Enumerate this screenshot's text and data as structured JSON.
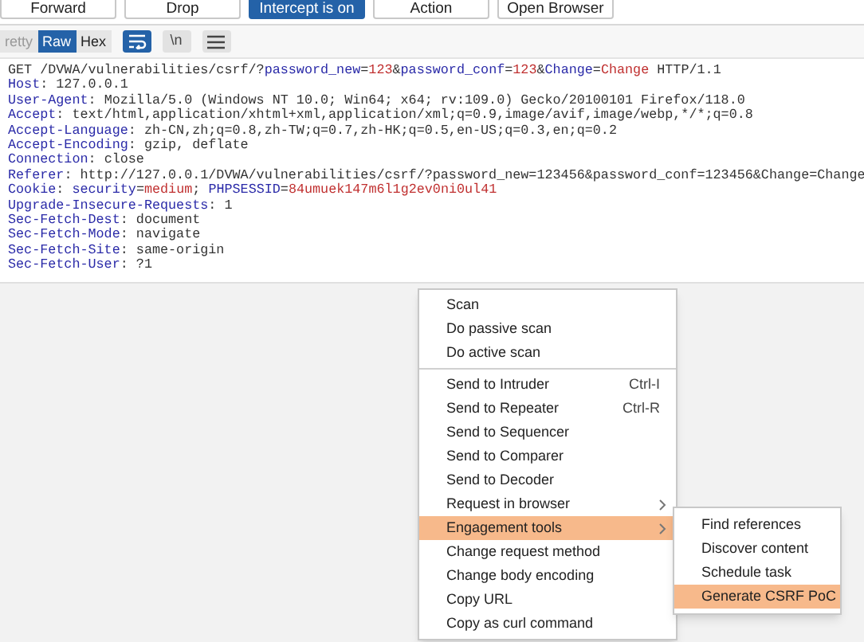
{
  "toolbar": {
    "buttons": [
      {
        "label": "Forward",
        "selected": false
      },
      {
        "label": "Drop",
        "selected": false
      },
      {
        "label": "Intercept is on",
        "selected": true
      },
      {
        "label": "Action",
        "selected": false
      },
      {
        "label": "Open Browser",
        "selected": false
      }
    ]
  },
  "view_tabs": [
    {
      "label": "retty",
      "selected": false,
      "disabled": true
    },
    {
      "label": "Raw",
      "selected": true,
      "disabled": false
    },
    {
      "label": "Hex",
      "selected": false,
      "disabled": false
    }
  ],
  "view_toggles": [
    {
      "kind": "wrap",
      "selected": true
    },
    {
      "kind": "text",
      "label": "\\n",
      "selected": false
    },
    {
      "kind": "menu",
      "selected": false
    }
  ],
  "request_lines": [
    [
      {
        "kind": "plain",
        "text": "GET /DVWA/vulnerabilities/csrf/?"
      },
      {
        "kind": "key",
        "text": "password_new"
      },
      {
        "kind": "plain",
        "text": "="
      },
      {
        "kind": "val",
        "text": "123"
      },
      {
        "kind": "plain",
        "text": "&"
      },
      {
        "kind": "key",
        "text": "password_conf"
      },
      {
        "kind": "plain",
        "text": "="
      },
      {
        "kind": "val",
        "text": "123"
      },
      {
        "kind": "plain",
        "text": "&"
      },
      {
        "kind": "key",
        "text": "Change"
      },
      {
        "kind": "plain",
        "text": "="
      },
      {
        "kind": "val",
        "text": "Change"
      },
      {
        "kind": "plain",
        "text": " HTTP/1.1"
      }
    ],
    [
      {
        "kind": "key",
        "text": "Host"
      },
      {
        "kind": "plain",
        "text": ": 127.0.0.1"
      }
    ],
    [
      {
        "kind": "key",
        "text": "User-Agent"
      },
      {
        "kind": "plain",
        "text": ": Mozilla/5.0 (Windows NT 10.0; Win64; x64; rv:109.0) Gecko/20100101 Firefox/118.0"
      }
    ],
    [
      {
        "kind": "key",
        "text": "Accept"
      },
      {
        "kind": "plain",
        "text": ": text/html,application/xhtml+xml,application/xml;q=0.9,image/avif,image/webp,*/*;q=0.8"
      }
    ],
    [
      {
        "kind": "key",
        "text": "Accept-Language"
      },
      {
        "kind": "plain",
        "text": ": zh-CN,zh;q=0.8,zh-TW;q=0.7,zh-HK;q=0.5,en-US;q=0.3,en;q=0.2"
      }
    ],
    [
      {
        "kind": "key",
        "text": "Accept-Encoding"
      },
      {
        "kind": "plain",
        "text": ": gzip, deflate"
      }
    ],
    [
      {
        "kind": "key",
        "text": "Connection"
      },
      {
        "kind": "plain",
        "text": ": close"
      }
    ],
    [
      {
        "kind": "key",
        "text": "Referer"
      },
      {
        "kind": "plain",
        "text": ": http://127.0.0.1/DVWA/vulnerabilities/csrf/?password_new=123456&password_conf=123456&Change=Change"
      }
    ],
    [
      {
        "kind": "key",
        "text": "Cookie"
      },
      {
        "kind": "plain",
        "text": ": "
      },
      {
        "kind": "key",
        "text": "security"
      },
      {
        "kind": "plain",
        "text": "="
      },
      {
        "kind": "val",
        "text": "medium"
      },
      {
        "kind": "plain",
        "text": "; "
      },
      {
        "kind": "key",
        "text": "PHPSESSID"
      },
      {
        "kind": "plain",
        "text": "="
      },
      {
        "kind": "val",
        "text": "84umuek147m6l1g2ev0ni0ul41"
      }
    ],
    [
      {
        "kind": "key",
        "text": "Upgrade-Insecure-Requests"
      },
      {
        "kind": "plain",
        "text": ": 1"
      }
    ],
    [
      {
        "kind": "key",
        "text": "Sec-Fetch-Dest"
      },
      {
        "kind": "plain",
        "text": ": document"
      }
    ],
    [
      {
        "kind": "key",
        "text": "Sec-Fetch-Mode"
      },
      {
        "kind": "plain",
        "text": ": navigate"
      }
    ],
    [
      {
        "kind": "key",
        "text": "Sec-Fetch-Site"
      },
      {
        "kind": "plain",
        "text": ": same-origin"
      }
    ],
    [
      {
        "kind": "key",
        "text": "Sec-Fetch-User"
      },
      {
        "kind": "plain",
        "text": ": ?1"
      }
    ]
  ],
  "context_menu": {
    "groups": [
      [
        {
          "label": "Scan",
          "selected": false,
          "submenu": false
        },
        {
          "label": "Do passive scan",
          "selected": false,
          "submenu": false
        },
        {
          "label": "Do active scan",
          "selected": false,
          "submenu": false
        }
      ],
      [
        {
          "label": "Send to Intruder",
          "shortcut": "Ctrl-I",
          "selected": false,
          "submenu": false
        },
        {
          "label": "Send to Repeater",
          "shortcut": "Ctrl-R",
          "selected": false,
          "submenu": false
        },
        {
          "label": "Send to Sequencer",
          "selected": false,
          "submenu": false
        },
        {
          "label": "Send to Comparer",
          "selected": false,
          "submenu": false
        },
        {
          "label": "Send to Decoder",
          "selected": false,
          "submenu": false
        },
        {
          "label": "Request in browser",
          "selected": false,
          "submenu": true
        },
        {
          "label": "Engagement tools",
          "selected": true,
          "submenu": true
        },
        {
          "label": "Change request method",
          "selected": false,
          "submenu": false
        },
        {
          "label": "Change body encoding",
          "selected": false,
          "submenu": false
        },
        {
          "label": "Copy URL",
          "selected": false,
          "submenu": false
        },
        {
          "label": "Copy as curl command",
          "selected": false,
          "submenu": false
        }
      ]
    ]
  },
  "submenu": [
    {
      "label": "Find references",
      "selected": false
    },
    {
      "label": "Discover content",
      "selected": false
    },
    {
      "label": "Schedule task",
      "selected": false
    },
    {
      "label": "Generate CSRF PoC",
      "selected": true
    }
  ]
}
